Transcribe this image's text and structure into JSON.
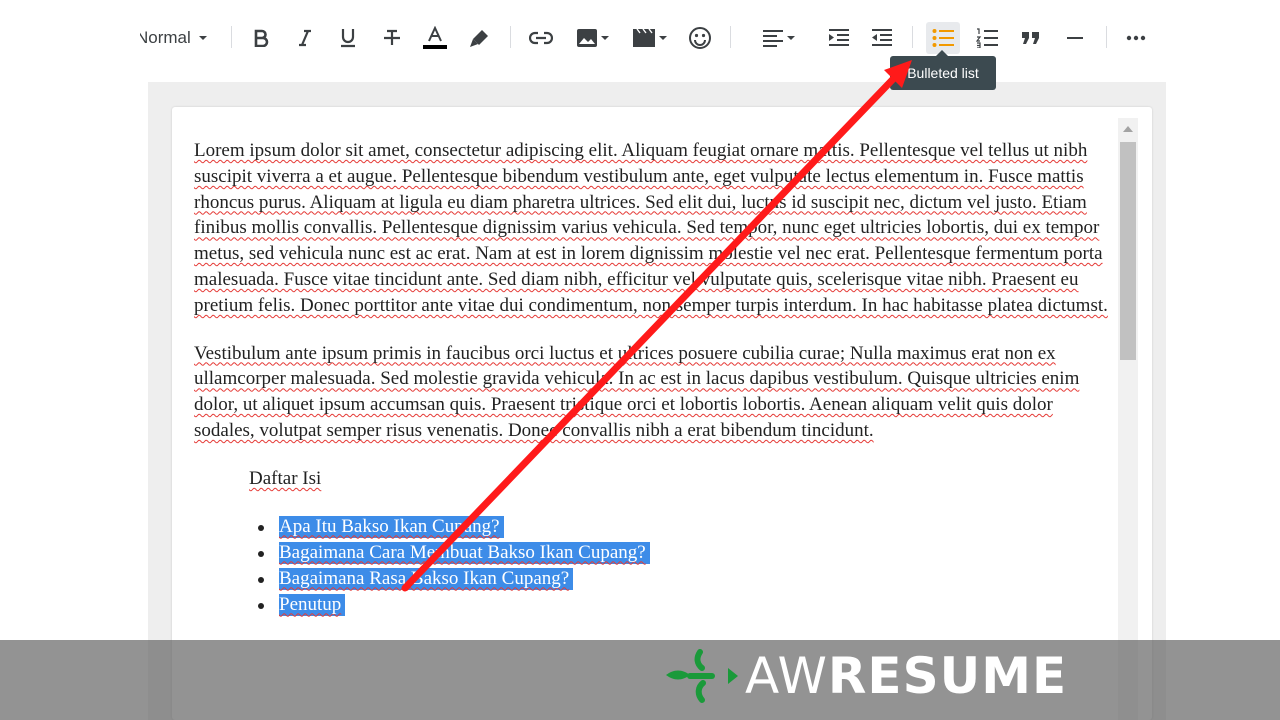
{
  "toolbar": {
    "style_select_value": "Normal",
    "buttons": [
      {
        "name": "bold",
        "icon": "bold-icon"
      },
      {
        "name": "italic",
        "icon": "italic-icon"
      },
      {
        "name": "underline",
        "icon": "underline-icon"
      },
      {
        "name": "strikethrough",
        "icon": "strikethrough-icon"
      },
      {
        "name": "text-color",
        "icon": "text-color-icon"
      },
      {
        "name": "highlight",
        "icon": "highlighter-icon"
      },
      {
        "name": "link",
        "icon": "link-icon"
      },
      {
        "name": "image",
        "icon": "image-icon"
      },
      {
        "name": "video",
        "icon": "video-icon"
      },
      {
        "name": "emoji",
        "icon": "smiley-icon"
      },
      {
        "name": "align",
        "icon": "align-left-icon"
      },
      {
        "name": "indent",
        "icon": "indent-icon"
      },
      {
        "name": "outdent",
        "icon": "outdent-icon"
      },
      {
        "name": "bulleted-list",
        "icon": "bulleted-list-icon",
        "active": true
      },
      {
        "name": "numbered-list",
        "icon": "numbered-list-icon"
      },
      {
        "name": "quote",
        "icon": "quote-icon"
      },
      {
        "name": "horizontal-rule",
        "icon": "horizontal-rule-icon"
      },
      {
        "name": "more",
        "icon": "more-icon"
      }
    ],
    "active_color": "#f29900",
    "tooltip": "Bulleted list"
  },
  "editor": {
    "paragraph_1": "Lorem ipsum dolor sit amet, consectetur adipiscing elit. Aliquam feugiat ornare mattis. Pellentesque vel tellus ut nibh suscipit viverra a et augue. Pellentesque bibendum vestibulum ante, eget vulputate lectus elementum in. Fusce mattis rhoncus purus. Aliquam at ligula eu diam pharetra ultrices. Sed elit dui, luctus id suscipit nec, dictum vel justo. Etiam finibus mollis convallis. Pellentesque dignissim varius vehicula. Sed tempor, nunc eget ultricies lobortis, dui ex tempor metus, sed vehicula nunc est ac erat. Nam at est in lorem dignissim molestie vel nec erat. Pellentesque fermentum porta malesuada. Fusce vitae tincidunt ante. Sed diam nibh, efficitur vel vulputate quis, scelerisque vitae nibh. Praesent eu pretium felis. Donec porttitor ante vitae dui condimentum, non semper turpis interdum. In hac habitasse platea dictumst.",
    "paragraph_2": "Vestibulum ante ipsum primis in faucibus orci luctus et ultrices posuere cubilia curae; Nulla maximus erat non ex ullamcorper malesuada. Sed molestie gravida vehicula. In ac est in lacus dapibus vestibulum. Quisque ultricies enim dolor, ut aliquet ipsum accumsan quis. Praesent tristique orci et lobortis lobortis. Aenean aliquam velit quis dolor sodales, volutpat semper risus venenatis. Donec convallis nibh a erat bibendum tincidunt.",
    "toc_title": "Daftar Isi",
    "toc_items": [
      "Apa Itu Bakso Ikan Cupang?",
      "Bagaimana Cara Membuat Bakso Ikan Cupang?",
      "Bagaimana Rasa Bakso Ikan Cupang?",
      "Penutup"
    ],
    "selection_color": "#3d8ce8",
    "spellcheck_color": "#e53935"
  },
  "annotation": {
    "arrow_color": "#ff1a1a"
  },
  "watermark": {
    "text_light": "AW",
    "text_bold": "RESUME",
    "logo_color": "#1a9a3a"
  }
}
